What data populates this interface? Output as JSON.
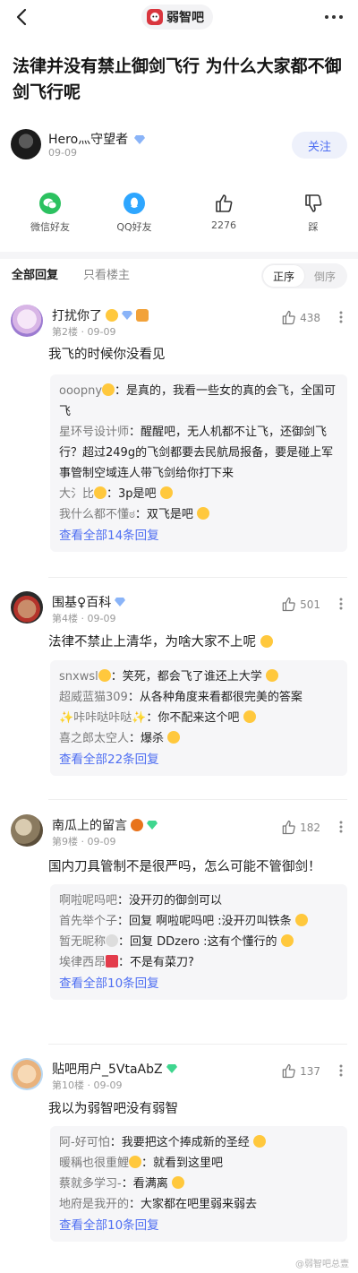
{
  "topbar": {
    "forum_name": "弱智吧"
  },
  "post": {
    "title": "法律并没有禁止御剑飞行 为什么大家都不御剑飞行呢",
    "author": "Hero灬守望者",
    "date": "09-09",
    "follow_label": "关注"
  },
  "actions": {
    "wechat": "微信好友",
    "qq": "QQ好友",
    "like_count": "2276",
    "dislike": "踩"
  },
  "tabs": {
    "all": "全部回复",
    "op_only": "只看楼主",
    "asc": "正序",
    "desc": "倒序"
  },
  "floors": [
    {
      "user": "打扰你了",
      "floor": "第2楼",
      "date": "09-09",
      "likes": "438",
      "content": "我飞的时候你没看见",
      "replies": [
        {
          "name": "ooopny",
          "text": "：是真的，我看一些女的真的会飞，全国可飞"
        },
        {
          "name": "星环号设计师",
          "text": "：醒醒吧，无人机都不让飞，还御剑飞行？超过249g的飞剑都要去民航局报备，要是碰上军事管制空域连人带飞剑给你打下来"
        },
        {
          "name": "大氵比",
          "text": "：3p是吧"
        },
        {
          "name": "我什么都不懂ಠ",
          "text": "：双飞是吧"
        }
      ],
      "view_all": "查看全部14条回复"
    },
    {
      "user": "围基♀百科",
      "floor": "第4楼",
      "date": "09-09",
      "likes": "501",
      "content": "法律不禁止上清华，为啥大家不上呢",
      "replies": [
        {
          "name": "snxwsl",
          "text": "：笑死，都会飞了谁还上大学"
        },
        {
          "name": "超威蓝猫309",
          "text": "：从各种角度来看都很完美的答案"
        },
        {
          "name": "咔咔哒咔哒",
          "text": "：你不配来这个吧"
        },
        {
          "name": "喜之郎太空人",
          "text": "：爆杀"
        }
      ],
      "view_all": "查看全部22条回复"
    },
    {
      "user": "南瓜上的留言",
      "floor": "第9楼",
      "date": "09-09",
      "likes": "182",
      "content": "国内刀具管制不是很严吗，怎么可能不管御剑！",
      "replies": [
        {
          "name": "啊啦呢吗吧",
          "text": "：没开刃的御剑可以"
        },
        {
          "name": "首先举个子",
          "text": "：回复 啊啦呢吗吧 :没开刃叫铁条"
        },
        {
          "name": "暂无昵称",
          "text": "：回复 DDzero :这有个懂行的"
        },
        {
          "name": "埃律西昂",
          "text": "：不是有菜刀?"
        }
      ],
      "view_all": "查看全部10条回复"
    },
    {
      "user": "贴吧用户_5VtaAbZ",
      "floor": "第10楼",
      "date": "09-09",
      "likes": "137",
      "content": "我以为弱智吧没有弱智",
      "replies": [
        {
          "name": "阿-好可怕",
          "text": "：我要把这个捧成新的圣经"
        },
        {
          "name": "暖稱也很重鯉",
          "text": "：就看到这里吧"
        },
        {
          "name": "蔡就多学习-",
          "text": "：看满离"
        },
        {
          "name": "地府是我开的",
          "text": "：大家都在吧里弱来弱去"
        }
      ],
      "view_all": "查看全部10条回复"
    }
  ],
  "watermark": "@弱智吧总壹"
}
